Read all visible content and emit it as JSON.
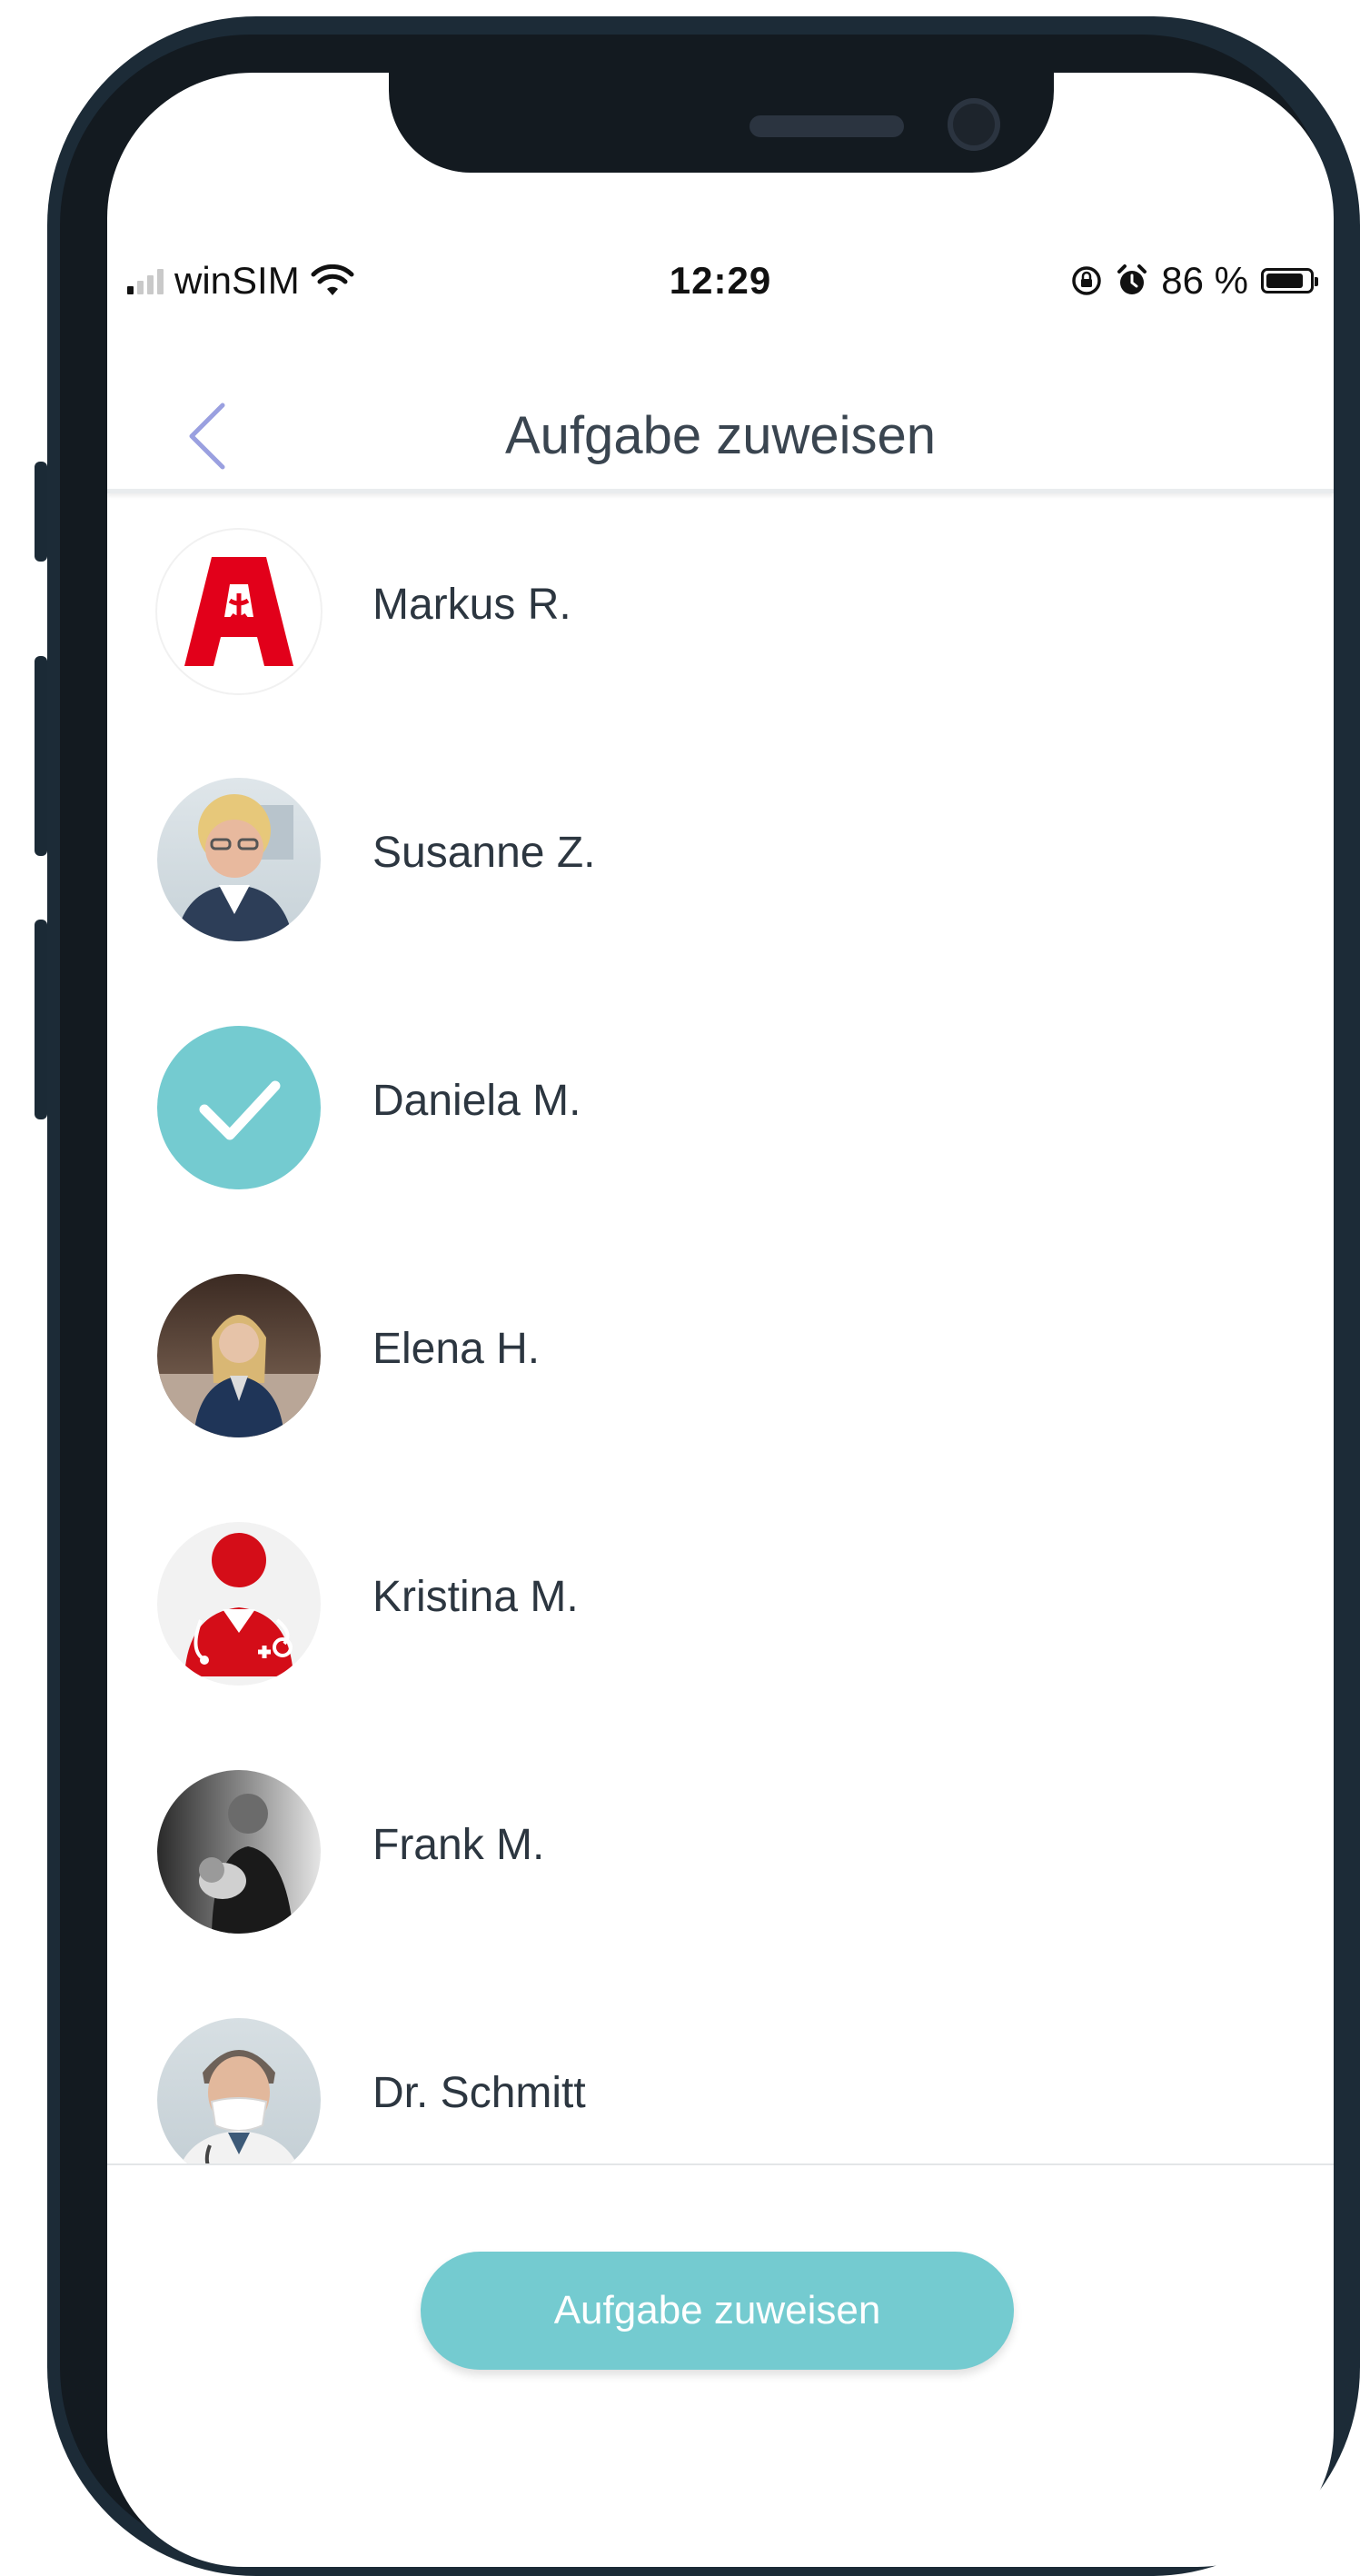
{
  "status_bar": {
    "carrier": "winSIM",
    "time": "12:29",
    "battery": "86 %",
    "battery_level": 0.86,
    "icons": [
      "signal-icon",
      "wifi-icon",
      "rotation-lock-icon",
      "alarm-icon",
      "battery-icon"
    ]
  },
  "nav": {
    "title": "Aufgabe zuweisen",
    "back_icon": "chevron-left-icon"
  },
  "assignees": [
    {
      "name": "Markus R.",
      "avatar": "pharmacy-logo",
      "selected": false
    },
    {
      "name": "Susanne Z.",
      "avatar": "photo",
      "selected": false
    },
    {
      "name": "Daniela M.",
      "avatar": "checkmark",
      "selected": true
    },
    {
      "name": "Elena H.",
      "avatar": "photo",
      "selected": false
    },
    {
      "name": "Kristina M.",
      "avatar": "nurse-icon",
      "selected": false
    },
    {
      "name": "Frank M.",
      "avatar": "photo",
      "selected": false
    },
    {
      "name": "Dr. Schmitt",
      "avatar": "photo",
      "selected": false
    }
  ],
  "footer": {
    "assign_button_label": "Aufgabe zuweisen"
  },
  "colors": {
    "accent": "#74cbd0",
    "pharmacy_red": "#e2001a",
    "frame": "#1c2b37"
  }
}
